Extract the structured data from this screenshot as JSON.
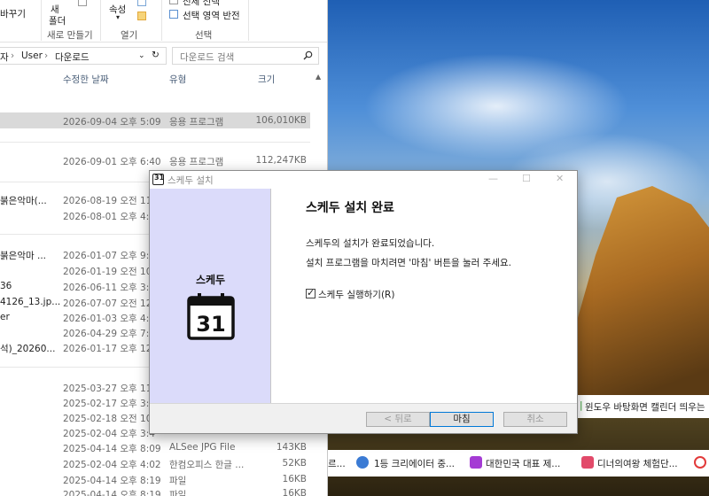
{
  "explorer": {
    "ribbon": {
      "new_folder_top": "새",
      "new_folder_bottom": "폴더",
      "rename": "바꾸기",
      "properties": "속성",
      "group_new": "새로 만들기",
      "group_open": "열기",
      "group_select": "선택",
      "select_partial": "전체 선택",
      "invert_selection": "선택 영역 반전"
    },
    "address": {
      "crumb0": "자",
      "crumb1": "User",
      "crumb2": "다운로드",
      "search_placeholder": "다운로드 검색"
    },
    "columns": {
      "modified": "수정한 날짜",
      "type": "유형",
      "size": "크기"
    },
    "rows": [
      {
        "name": "",
        "date": "2026-09-04 오후 5:09",
        "type": "응용 프로그램",
        "size": "106,010KB"
      },
      {
        "name": "",
        "date": "2026-09-01 오후 6:40",
        "type": "응용 프로그램",
        "size": "112,247KB"
      },
      {
        "name": "붉은악마(...",
        "date": "2026-08-19 오전 11:",
        "type": "",
        "size": ""
      },
      {
        "name": "",
        "date": "2026-08-01 오후 4:2",
        "type": "",
        "size": ""
      },
      {
        "name": "붉은악마 ...",
        "date": "2026-01-07 오후 9:5",
        "type": "",
        "size": ""
      },
      {
        "name": "",
        "date": "2026-01-19 오전 10:",
        "type": "",
        "size": ""
      },
      {
        "name": "36",
        "date": "2026-06-11 오후 3:1",
        "type": "",
        "size": ""
      },
      {
        "name": "4126_13.jp...",
        "date": "2026-07-07 오전 12:",
        "type": "",
        "size": ""
      },
      {
        "name": "er",
        "date": "2026-01-03 오후 4:5",
        "type": "",
        "size": ""
      },
      {
        "name": "",
        "date": "2026-04-29 오후 7:0",
        "type": "",
        "size": ""
      },
      {
        "name": "석)_20260...",
        "date": "2026-01-17 오후 12:",
        "type": "",
        "size": ""
      },
      {
        "name": "",
        "date": "2025-03-27 오후 11:",
        "type": "",
        "size": ""
      },
      {
        "name": "",
        "date": "2025-02-17 오후 3:4",
        "type": "",
        "size": ""
      },
      {
        "name": "",
        "date": "2025-02-18 오전 10:",
        "type": "",
        "size": ""
      },
      {
        "name": "",
        "date": "2025-02-04 오후 3:4",
        "type": "",
        "size": ""
      },
      {
        "name": "",
        "date": "2025-04-14 오후 8:09",
        "type": "ALSee JPG File",
        "size": "143KB"
      },
      {
        "name": "",
        "date": "2025-02-04 오후 4:02",
        "type": "한컴오피스 한글 ...",
        "size": "52KB"
      },
      {
        "name": "",
        "date": "2025-04-14 오후 8:19",
        "type": "파일",
        "size": "16KB"
      },
      {
        "name": "",
        "date": "2025-04-14 오후 8:19",
        "type": "파일",
        "size": "16KB"
      }
    ]
  },
  "dialog": {
    "title": "스케두 설치",
    "brand": "스케두",
    "calendar_number": "31",
    "heading": "스케두 설치 완료",
    "line1": "스케두의 설치가 완료되었습니다.",
    "line2": "설치 프로그램을 마치려면 '마침' 버튼을 눌러 주세요.",
    "checkbox_label": "스케두 실행하기(R)",
    "checkbox_checked": true,
    "back_button": "< 뒤로",
    "finish_button": "마침",
    "cancel_button": "취소"
  },
  "notice": {
    "text": "윈도우 바탕화면 캘린더 띄우는"
  },
  "taskbar": {
    "item0": "르...",
    "item1": "1등 크리에이터 중...",
    "item2": "대한민국 대표 제...",
    "item3": "디너의여왕 체험단..."
  },
  "colors": {
    "accent": "#0078d7",
    "selected_row": "#d9d9d9",
    "installer_panel": "#dbdbfa"
  }
}
